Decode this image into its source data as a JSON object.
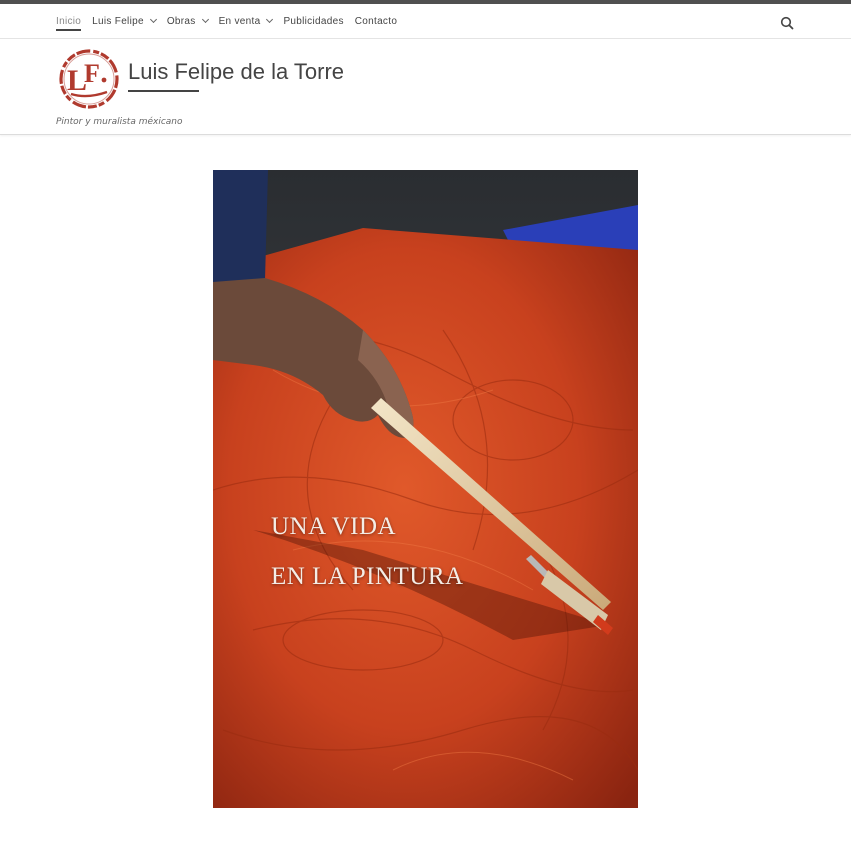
{
  "nav": {
    "items": [
      {
        "label": "Inicio",
        "active": true,
        "dropdown": false
      },
      {
        "label": "Luis Felipe",
        "active": false,
        "dropdown": true
      },
      {
        "label": "Obras",
        "active": false,
        "dropdown": true
      },
      {
        "label": "En venta",
        "active": false,
        "dropdown": true
      },
      {
        "label": "Publicidades",
        "active": false,
        "dropdown": false
      },
      {
        "label": "Contacto",
        "active": false,
        "dropdown": false
      }
    ],
    "search_icon": "search-icon"
  },
  "header": {
    "site_title": "Luis Felipe de la Torre",
    "tagline": "Pintor y muralista méxicano",
    "logo_text": "LF.",
    "logo_icon": "seal-logo"
  },
  "hero": {
    "line1": "UNA VIDA",
    "line2": "EN LA PINTURA"
  },
  "colors": {
    "top_strip": "#505050",
    "text": "#444444",
    "active_nav": "#888888",
    "logo_red": "#b03a2e",
    "canvas_orange": "#c8411e"
  }
}
